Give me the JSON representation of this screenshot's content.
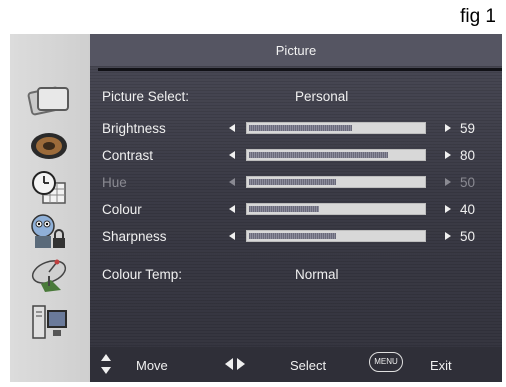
{
  "figure_label": "fig 1",
  "menu": {
    "title": "Picture",
    "sidebar_icons": [
      "picture-icon",
      "sound-icon",
      "clock-icon",
      "lock-icon",
      "satellite-icon",
      "computer-icon"
    ],
    "picture_select": {
      "label": "Picture Select:",
      "value": "Personal"
    },
    "settings": [
      {
        "label": "Brightness",
        "value": "59",
        "level": 0.59,
        "disabled": false
      },
      {
        "label": "Contrast",
        "value": "80",
        "level": 0.8,
        "disabled": false
      },
      {
        "label": "Hue",
        "value": "50",
        "level": 0.5,
        "disabled": true
      },
      {
        "label": "Colour",
        "value": "40",
        "level": 0.4,
        "disabled": false
      },
      {
        "label": "Sharpness",
        "value": "50",
        "level": 0.5,
        "disabled": false
      }
    ],
    "colour_temp": {
      "label": "Colour Temp:",
      "value": "Normal"
    }
  },
  "footer": {
    "move_label": "Move",
    "select_label": "Select",
    "menu_badge": "MENU",
    "exit_label": "Exit"
  }
}
